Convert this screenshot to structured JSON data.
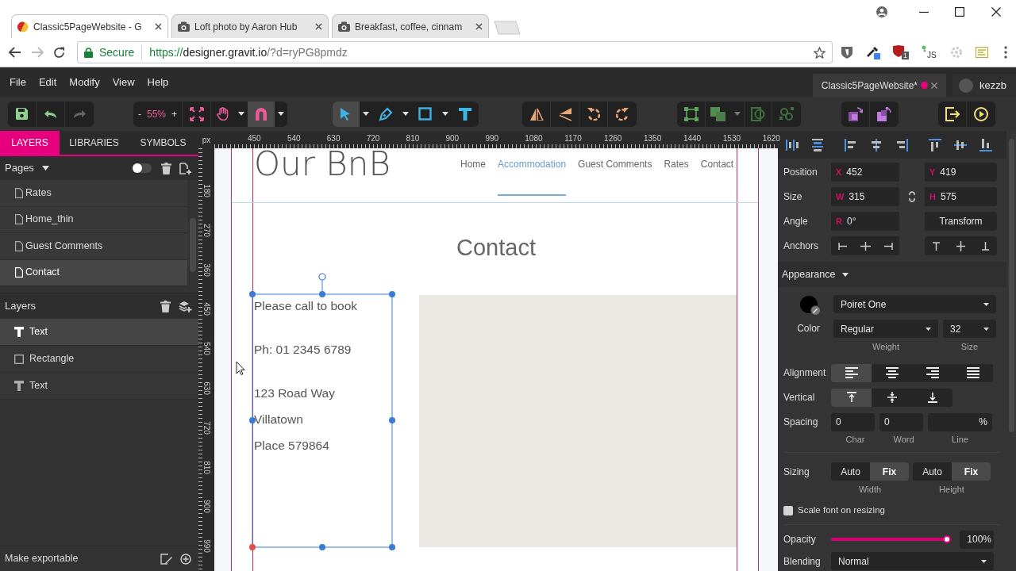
{
  "browser": {
    "tabs": [
      {
        "title": "Classic5PageWebsite - G",
        "selected": true
      },
      {
        "title": "Loft photo by Aaron Hub",
        "selected": false
      },
      {
        "title": "Breakfast, coffee, cinnam",
        "selected": false
      }
    ],
    "forward_disabled": true,
    "address": {
      "security": "Secure",
      "scheme": "https://",
      "host": "designer.gravit.io",
      "path": "/?d=ryPG8pmdz"
    },
    "extensions": [
      {
        "kind": "shield"
      },
      {
        "kind": "dropper"
      },
      {
        "kind": "ublock",
        "badge": "1"
      },
      {
        "kind": "script",
        "label": "JS"
      },
      {
        "kind": "gear"
      },
      {
        "kind": "notes"
      }
    ]
  },
  "app": {
    "menu": [
      "File",
      "Edit",
      "Modify",
      "View",
      "Help"
    ],
    "document_tab": {
      "title": "Classic5PageWebsite*",
      "unsaved": true
    },
    "user": {
      "name": "kezzb"
    },
    "toolbar": {
      "redo_disabled": true,
      "zoom": {
        "minus": "-",
        "value": "55%",
        "plus": "+"
      },
      "snapping": true,
      "tools": [
        {
          "kind": "pointer",
          "selected": true
        },
        {
          "kind": "pen",
          "selected": false
        },
        {
          "kind": "shape",
          "selected": false
        },
        {
          "kind": "text",
          "selected": false
        }
      ]
    }
  },
  "left_panel": {
    "tabs": [
      {
        "label": "LAYERS",
        "selected": true
      },
      {
        "label": "LIBRARIES",
        "selected": false
      },
      {
        "label": "SYMBOLS",
        "selected": false
      }
    ],
    "pages": {
      "title": "Pages",
      "toggle_on": false,
      "items": [
        {
          "name": "Rates",
          "selected": false
        },
        {
          "name": "Home_thin",
          "selected": false
        },
        {
          "name": "Guest Comments",
          "selected": false
        },
        {
          "name": "Contact",
          "selected": true
        }
      ]
    },
    "layers": {
      "title": "Layers",
      "items": [
        {
          "kind": "text",
          "name": "Text",
          "selected": true
        },
        {
          "kind": "rectangle",
          "name": "Rectangle",
          "selected": false
        },
        {
          "kind": "text",
          "name": "Text",
          "selected": false
        }
      ]
    },
    "footer": "Make exportable"
  },
  "rulers": {
    "unit": "px",
    "horizontal": [
      "450",
      "540",
      "630",
      "720",
      "810",
      "900",
      "990",
      "1080",
      "1170",
      "1260",
      "1350",
      "1440",
      "1530",
      "1620"
    ],
    "vertical": [
      "180",
      "270",
      "360",
      "450",
      "540",
      "630",
      "720",
      "810",
      "900",
      "990"
    ]
  },
  "artboard": {
    "logo": "Our BnB",
    "nav": [
      {
        "label": "Home",
        "selected": false
      },
      {
        "label": "Accommodation",
        "selected": true
      },
      {
        "label": "Guest Comments",
        "selected": false
      },
      {
        "label": "Rates",
        "selected": false
      },
      {
        "label": "Contact",
        "selected": false
      }
    ],
    "heading": "Contact",
    "text_blocks": [
      [
        "Please call to book"
      ],
      [
        "Ph: 01 2345 6789"
      ],
      [
        "123 Road Way",
        "Villatown",
        "Place 579864"
      ]
    ]
  },
  "properties": {
    "geometry": [
      {
        "label": "Position",
        "fields": [
          {
            "prefix": "X",
            "value": "452"
          },
          {
            "prefix": "Y",
            "value": "419"
          }
        ]
      },
      {
        "label": "Size",
        "fields": [
          {
            "prefix": "W",
            "value": "315"
          },
          {
            "prefix": "H",
            "value": "575"
          }
        ]
      },
      {
        "label": "Angle",
        "fields": [
          {
            "prefix": "R",
            "value": "0°"
          }
        ],
        "button": "Transform"
      }
    ],
    "anchors_label": "Anchors",
    "appearance": {
      "title": "Appearance",
      "color_label": "Color",
      "font": "Poiret One",
      "weight": "Regular",
      "size": "32",
      "weight_label": "Weight",
      "size_label": "Size"
    },
    "alignment": {
      "label": "Alignment",
      "options": [
        {
          "kind": "left",
          "selected": true
        },
        {
          "kind": "center",
          "selected": false
        },
        {
          "kind": "right",
          "selected": false
        },
        {
          "kind": "justify",
          "selected": false
        }
      ]
    },
    "vertical": {
      "label": "Vertical",
      "options": [
        {
          "kind": "top",
          "selected": true
        },
        {
          "kind": "middle",
          "selected": false
        },
        {
          "kind": "bottom",
          "selected": false
        }
      ]
    },
    "spacing": {
      "label": "Spacing",
      "fields": [
        {
          "value": "0",
          "caption": "Char"
        },
        {
          "value": "0",
          "caption": "Word"
        },
        {
          "unit": "%",
          "caption": "Line"
        }
      ]
    },
    "sizing": {
      "label": "Sizing",
      "groups": [
        {
          "caption": "Width",
          "options": [
            {
              "label": "Auto",
              "selected": false
            },
            {
              "label": "Fix",
              "selected": true
            }
          ]
        },
        {
          "caption": "Height",
          "options": [
            {
              "label": "Auto",
              "selected": false
            },
            {
              "label": "Fix",
              "selected": true
            }
          ]
        }
      ]
    },
    "scale_font": {
      "label": "Scale font on resizing",
      "checked": false
    },
    "opacity": {
      "label": "Opacity",
      "level": 1,
      "reading": "100%"
    },
    "blending": {
      "label": "Blending",
      "value": "Normal"
    }
  }
}
